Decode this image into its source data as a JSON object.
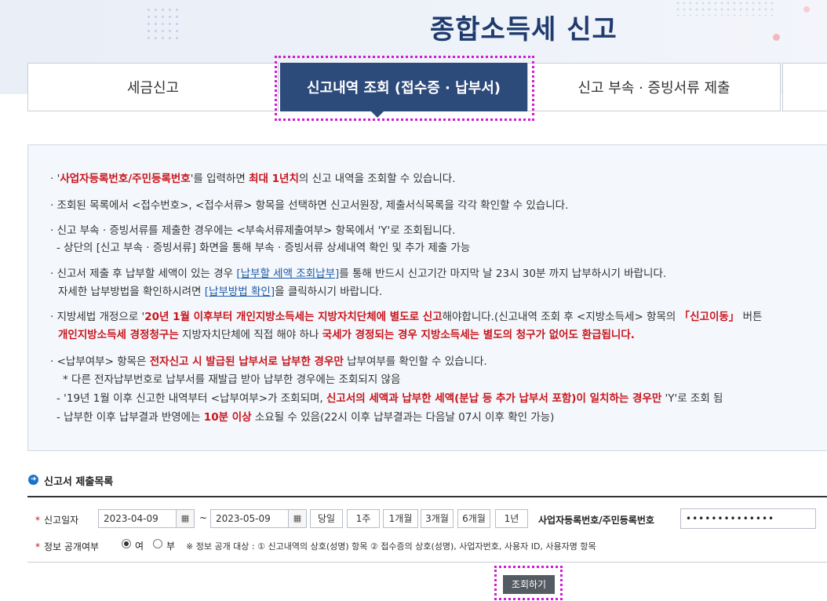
{
  "page": {
    "title": "종합소득세 신고"
  },
  "tabs": [
    {
      "label": "세금신고",
      "active": false
    },
    {
      "label": "신고내역 조회 (접수증 · 납부서)",
      "active": true
    },
    {
      "label": "신고 부속 · 증빙서류 제출",
      "active": false
    }
  ],
  "info": {
    "l1a": "'",
    "l1b": "사업자등록번호/주민등록번호",
    "l1c": "'를 입력하면 ",
    "l1d": "최대 1년치",
    "l1e": "의 신고 내역을 조회할 수 있습니다.",
    "l2": "조회된 목록에서 <접수번호>, <접수서류> 항목을 선택하면 신고서원장, 제출서식목록을 각각 확인할 수 있습니다.",
    "l3": "신고 부속 · 증빙서류를 제출한 경우에는 <부속서류제출여부> 항목에서 'Y'로 조회됩니다.",
    "l3s": "- 상단의 [신고 부속 · 증빙서류] 화면을 통해 부속 · 증빙서류 상세내역 확인 및 추가 제출 가능",
    "l4a": "신고서 제출 후 납부할 세액이 있는 경우 ",
    "l4b": "[납부할 세액 조회납부]",
    "l4c": "를 통해 반드시 신고기간 마지막 날 23시 30분 까지 납부하시기 바랍니다.",
    "l4s_a": "자세한 납부방법을 확인하시려면 ",
    "l4s_b": "[납부방법 확인]",
    "l4s_c": "을 클릭하시기 바랍니다.",
    "l5a": "지방세법 개정으로 '",
    "l5b": "20년 1월 이후부터 개인지방소득세는 지방자치단체에 별도로 신고",
    "l5c": "해야합니다.(신고내역 조회 후 <지방소득세> 항목의 ",
    "l5d": "「신고이동」",
    "l5e": " 버튼",
    "l5s_a": "개인지방소득세 경정청구는",
    "l5s_b": " 지방자치단체에 직접 해야 하나 ",
    "l5s_c": "국세가 경정되는 경우 지방소득세는 별도의 청구가 없어도 환급됩니다.",
    "l6a": "<납부여부> 항목은 ",
    "l6b": "전자신고 시 발급된 납부서로 납부한 경우만",
    "l6c": " 납부여부를 확인할 수 있습니다.",
    "l6s1": "* 다른 전자납부번호로 납부서를 재발급 받아 납부한 경우에는 조회되지 않음",
    "l6s2a": "- '19년 1월 이후 신고한 내역부터 <납부여부>가 조회되며, ",
    "l6s2b": "신고서의 세액과 납부한 세액(분납 등 추가 납부서 포함)이 일치하는 경우만",
    "l6s2c": " 'Y'로 조회 됨",
    "l6s3a": "- 납부한 이후 납부결과 반영에는 ",
    "l6s3b": "10분 이상",
    "l6s3c": " 소요될 수 있음(22시 이후 납부결과는 다음날 07시 이후 확인 가능)"
  },
  "section": {
    "title": "신고서 제출목록"
  },
  "form": {
    "date_label": "신고일자",
    "date_from": "2023-04-09",
    "tilde": "~",
    "date_to": "2023-05-09",
    "period_buttons": [
      "당일",
      "1주",
      "1개월",
      "3개월",
      "6개월",
      "1년"
    ],
    "biz_label": "사업자등록번호/주민등록번호",
    "biz_value": "••••••••••••••",
    "public_label": "정보 공개여부",
    "radio_yes": "여",
    "radio_no": "부",
    "public_note": "※ 정보 공개 대상 : ① 신고내역의 상호(성명) 항목 ② 접수증의 상호(성명), 사업자번호, 사용자 ID, 사용자명 항목",
    "selected": "여"
  },
  "search_button": "조회하기",
  "colors": {
    "tab_active": "#2c4a7a",
    "highlight": "#d11bd0",
    "emphasis_red": "#c8161d"
  }
}
